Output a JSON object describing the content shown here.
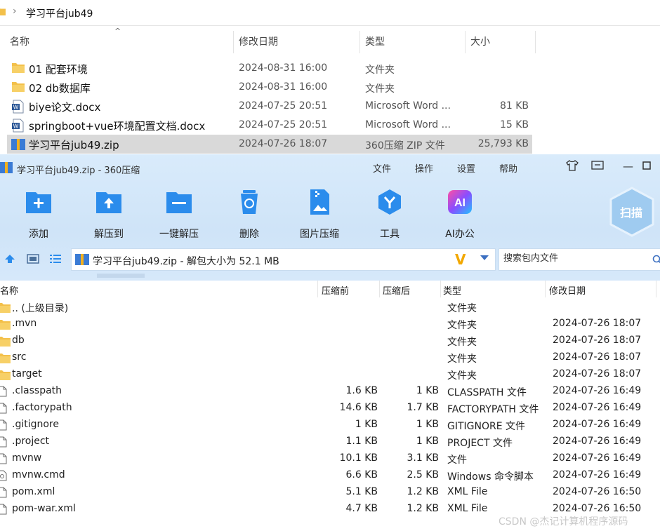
{
  "explorer": {
    "breadcrumb": "学习平台jub49",
    "columns": {
      "name": "名称",
      "modified": "修改日期",
      "type": "类型",
      "size": "大小"
    },
    "rows": [
      {
        "name": "01 配套环境",
        "date": "2024-08-31 16:00",
        "type": "文件夹",
        "size": "",
        "icon": "folder-icon",
        "selected": false
      },
      {
        "name": "02 db数据库",
        "date": "2024-08-31 16:00",
        "type": "文件夹",
        "size": "",
        "icon": "folder-icon",
        "selected": false
      },
      {
        "name": "biye论文.docx",
        "date": "2024-07-25 20:51",
        "type": "Microsoft Word ...",
        "size": "81 KB",
        "icon": "word-doc-icon",
        "selected": false
      },
      {
        "name": "springboot+vue环境配置文档.docx",
        "date": "2024-07-25 20:51",
        "type": "Microsoft Word ...",
        "size": "15 KB",
        "icon": "word-doc-icon",
        "selected": false
      },
      {
        "name": "学习平台jub49.zip",
        "date": "2024-07-26 18:07",
        "type": "360压缩 ZIP 文件",
        "size": "25,793 KB",
        "icon": "zip-archive-icon",
        "selected": true
      }
    ]
  },
  "zip": {
    "title": "学习平台jub49.zip - 360压缩",
    "menu": [
      "文件",
      "操作",
      "设置",
      "帮助"
    ],
    "toolbar": [
      {
        "label": "添加",
        "icon": "add-icon"
      },
      {
        "label": "解压到",
        "icon": "extract-to-icon"
      },
      {
        "label": "一键解压",
        "icon": "one-click-extract-icon"
      },
      {
        "label": "删除",
        "icon": "delete-icon"
      },
      {
        "label": "图片压缩",
        "icon": "image-compress-icon"
      },
      {
        "label": "工具",
        "icon": "tools-icon"
      },
      {
        "label": "AI办公",
        "icon": "ai-office-icon"
      }
    ],
    "scan_label": "扫描",
    "path": "学习平台jub49.zip - 解包大小为 52.1 MB",
    "search_placeholder": "搜索包内文件",
    "columns": {
      "name": "名称",
      "packed": "压缩前",
      "size": "压缩后",
      "type": "类型",
      "modified": "修改日期"
    },
    "rows": [
      {
        "name": ".. (上级目录)",
        "packed": "",
        "size": "",
        "type": "文件夹",
        "date": "",
        "icon": "folder-icon"
      },
      {
        "name": ".mvn",
        "packed": "",
        "size": "",
        "type": "文件夹",
        "date": "2024-07-26 18:07",
        "icon": "folder-icon"
      },
      {
        "name": "db",
        "packed": "",
        "size": "",
        "type": "文件夹",
        "date": "2024-07-26 18:07",
        "icon": "folder-icon"
      },
      {
        "name": "src",
        "packed": "",
        "size": "",
        "type": "文件夹",
        "date": "2024-07-26 18:07",
        "icon": "folder-icon"
      },
      {
        "name": "target",
        "packed": "",
        "size": "",
        "type": "文件夹",
        "date": "2024-07-26 18:07",
        "icon": "folder-icon"
      },
      {
        "name": ".classpath",
        "packed": "1.6 KB",
        "size": "1 KB",
        "type": "CLASSPATH 文件",
        "date": "2024-07-26 16:49",
        "icon": "file-icon"
      },
      {
        "name": ".factorypath",
        "packed": "14.6 KB",
        "size": "1.7 KB",
        "type": "FACTORYPATH 文件",
        "date": "2024-07-26 16:49",
        "icon": "file-icon"
      },
      {
        "name": ".gitignore",
        "packed": "1 KB",
        "size": "1 KB",
        "type": "GITIGNORE 文件",
        "date": "2024-07-26 16:49",
        "icon": "file-icon"
      },
      {
        "name": ".project",
        "packed": "1.1 KB",
        "size": "1 KB",
        "type": "PROJECT 文件",
        "date": "2024-07-26 16:49",
        "icon": "file-icon"
      },
      {
        "name": "mvnw",
        "packed": "10.1 KB",
        "size": "3.1 KB",
        "type": "文件",
        "date": "2024-07-26 16:49",
        "icon": "file-icon"
      },
      {
        "name": "mvnw.cmd",
        "packed": "6.6 KB",
        "size": "2.5 KB",
        "type": "Windows 命令脚本",
        "date": "2024-07-26 16:49",
        "icon": "script-icon"
      },
      {
        "name": "pom.xml",
        "packed": "5.1 KB",
        "size": "1.2 KB",
        "type": "XML File",
        "date": "2024-07-26 16:50",
        "icon": "file-icon"
      },
      {
        "name": "pom-war.xml",
        "packed": "4.7 KB",
        "size": "1.2 KB",
        "type": "XML File",
        "date": "2024-07-26 16:50",
        "icon": "file-icon"
      }
    ]
  },
  "watermark": "CSDN @杰记计算机程序源码",
  "colors": {
    "accent": "#2b8cec",
    "toolbar_bg": "#d4e7fa",
    "selection": "#d9d9d9",
    "folder": "#f3c04a"
  }
}
